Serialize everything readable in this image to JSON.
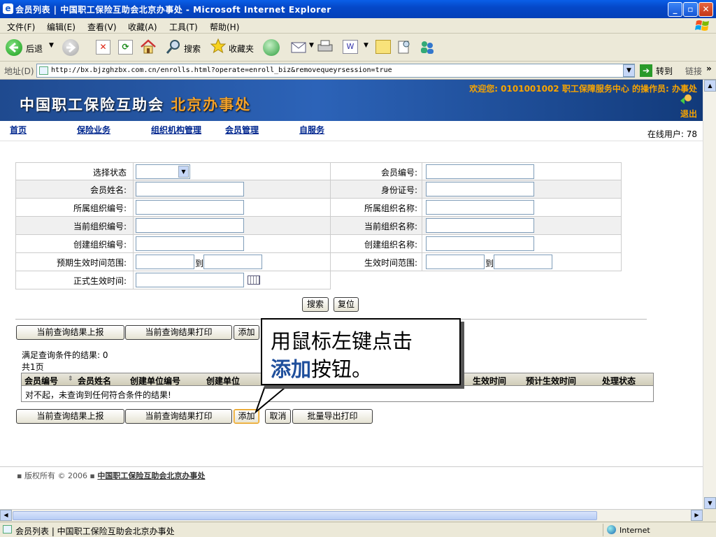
{
  "window": {
    "title": "会员列表 | 中国职工保险互助会北京办事处 - Microsoft Internet Explorer"
  },
  "menu": [
    "文件(F)",
    "编辑(E)",
    "查看(V)",
    "收藏(A)",
    "工具(T)",
    "帮助(H)"
  ],
  "toolbar": {
    "back": "后退",
    "search": "搜索",
    "favorites": "收藏夹"
  },
  "address": {
    "label": "地址(D)",
    "url": "http://bx.bjzghzbx.com.cn/enrolls.html?operate=enroll_biz&removequeyrsession=true",
    "go": "转到",
    "links": "链接"
  },
  "banner": {
    "brand_main": "中国职工保险互助会",
    "brand_sub": "北京办事处",
    "welcome": "欢迎您: 0101001002 职工保障服务中心 的操作员: 办事处",
    "logout": "退出"
  },
  "nav": {
    "items": [
      "首页",
      "保险业务",
      "组织机构管理",
      "会员管理",
      "自服务"
    ],
    "online": "在线用户: 78"
  },
  "form": {
    "labels": {
      "status": "选择状态",
      "member_no": "会员编号:",
      "member_name": "会员姓名:",
      "id_no": "身份证号:",
      "org_no": "所属组织编号:",
      "org_name": "所属组织名称:",
      "cur_org_no": "当前组织编号:",
      "cur_org_name": "当前组织名称:",
      "create_org_no": "创建组织编号:",
      "create_org_name": "创建组织名称:",
      "expected_range": "预期生效时间范围:",
      "effective_range": "生效时间范围:",
      "official_date": "正式生效时间:",
      "to1": "到",
      "to2": "到"
    },
    "search": "搜索",
    "reset": "复位"
  },
  "actions": {
    "report": "当前查询结果上报",
    "print": "当前查询结果打印",
    "add": "添加",
    "cancel": "取消",
    "batch": "批量导出打印"
  },
  "results": {
    "summary": "满足查询条件的结果: 0",
    "pages": "共1页",
    "columns": [
      "会员编号",
      "会员姓名",
      "创建单位编号",
      "创建单位",
      "生效时间",
      "预计生效时间",
      "处理状态"
    ],
    "empty": "对不起，未查询到任何符合条件的结果!"
  },
  "callout": {
    "line1": "用鼠标左键点击",
    "line2_highlight": "添加",
    "line2_rest": "按钮。"
  },
  "footer": {
    "copyright": "▪ 版权所有 © 2006 ▪",
    "org_link": "中国职工保险互助会北京办事处"
  },
  "status": {
    "text": "会员列表 | 中国职工保险互助会北京办事处",
    "zone": "Internet"
  }
}
